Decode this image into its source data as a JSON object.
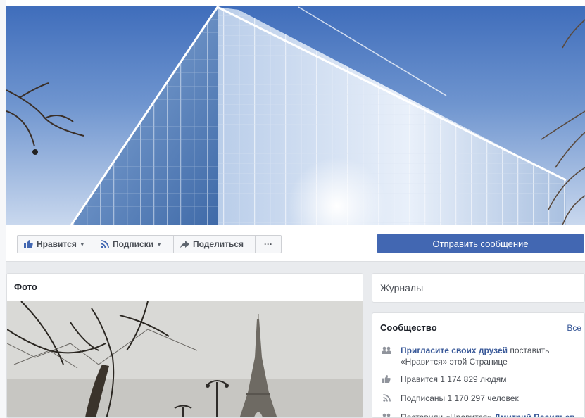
{
  "action_bar": {
    "like_label": "Нравится",
    "follow_label": "Подписки",
    "share_label": "Поделиться",
    "more_label": "···",
    "send_message_label": "Отправить сообщение"
  },
  "photos": {
    "title": "Фото"
  },
  "journals": {
    "label": "Журналы"
  },
  "community": {
    "title": "Сообщество",
    "see_all": "Все",
    "invite_link": "Пригласите своих друзей",
    "invite_line1_rest": " поставить",
    "invite_line2": "«Нравится» этой Странице",
    "likes_text": "Нравится 1 174 829 людям",
    "followers_text": "Подписаны 1 170 297 человек",
    "friends_prefix": "Поставили «Нравится» ",
    "friend_name": "Дмитрий Васильев"
  },
  "colors": {
    "accent": "#4267b2",
    "link": "#385898",
    "page_bg": "#e9ebee"
  }
}
